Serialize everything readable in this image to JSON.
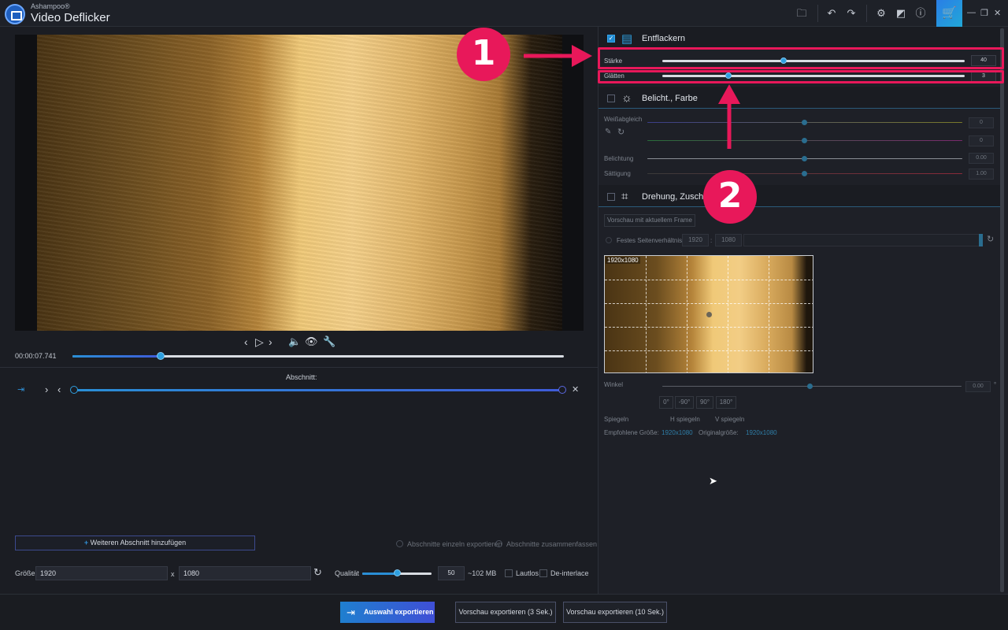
{
  "app": {
    "brand": "Ashampoo®",
    "name": "Video Deflicker"
  },
  "player": {
    "time": "00:00:07.741",
    "progress": 0.18
  },
  "section": {
    "label": "Abschnitt:",
    "add_button": "Weiteren Abschnitt hinzufügen",
    "export_separately": "Abschnitte einzeln exportieren",
    "merge_sections": "Abschnitte zusammenfassen"
  },
  "output": {
    "size_label": "Größe",
    "width": "1920",
    "x_sep": "x",
    "height": "1080",
    "quality_label": "Qualität",
    "quality_value": "50",
    "estimate": "~102 MB",
    "quality_level": 0.5,
    "lossless": "Lautlos",
    "deinterlace": "De-interlace"
  },
  "deflicker": {
    "title": "Entflackern",
    "strength_label": "Stärke",
    "strength_value": "40",
    "strength_level": 0.4,
    "smooth_label": "Glätten",
    "smooth_value": "3",
    "smooth_level": 0.22
  },
  "exposure": {
    "title": "Belicht., Farbe",
    "white_balance": "Weißabgleich",
    "wb1": "0",
    "wb2": "0",
    "exposure_label": "Belichtung",
    "exposure_value": "0.00",
    "saturation_label": "Sättigung",
    "saturation_value": "1.00"
  },
  "crop": {
    "title": "Drehung, Zuschn",
    "preview_frame": "Vorschau mit aktuellem Frame",
    "fixed_ratio": "Festes Seitenverhältnis",
    "ratio_w": "1920",
    "ratio_sep": ":",
    "ratio_h": "1080",
    "frame_size": "1920x1080",
    "angle_label": "Winkel",
    "angle_value": "0.00",
    "deg_unit": "°",
    "rot_buttons": [
      "0°",
      "-90°",
      "90°",
      "180°"
    ],
    "mirror_label": "Spiegeln",
    "h_mirror": "H spiegeln",
    "v_mirror": "V spiegeln",
    "recommended_label": "Empfohlene Größe:",
    "recommended_value": "1920x1080",
    "original_label": "Originalgröße:",
    "original_value": "1920x1080"
  },
  "annotations": {
    "badge1": "1",
    "badge2": "2"
  },
  "bottom": {
    "export": "Auswahl exportieren",
    "preview3": "Vorschau exportieren (3 Sek.)",
    "preview10": "Vorschau exportieren (10 Sek.)"
  },
  "colors": {
    "accent": "#1f8ad1",
    "annotation": "#e8185a",
    "export_gradient_start": "#1f7fcf",
    "export_gradient_end": "#3f4fd6"
  }
}
